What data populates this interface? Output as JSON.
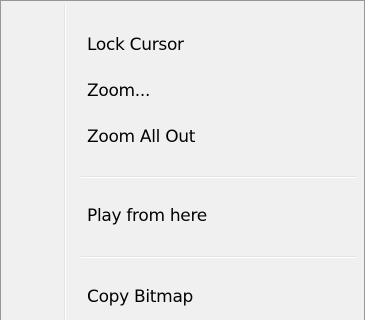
{
  "context_menu": {
    "items": [
      {
        "label": "Lock Cursor"
      },
      {
        "label": "Zoom..."
      },
      {
        "label": "Zoom All Out"
      },
      {
        "label": "Play from here"
      },
      {
        "label": "Copy Bitmap"
      }
    ]
  },
  "colors": {
    "menu_background": "#f0f0f0",
    "border": "#979797",
    "separator": "#e2e3e3",
    "text": "#000000"
  }
}
